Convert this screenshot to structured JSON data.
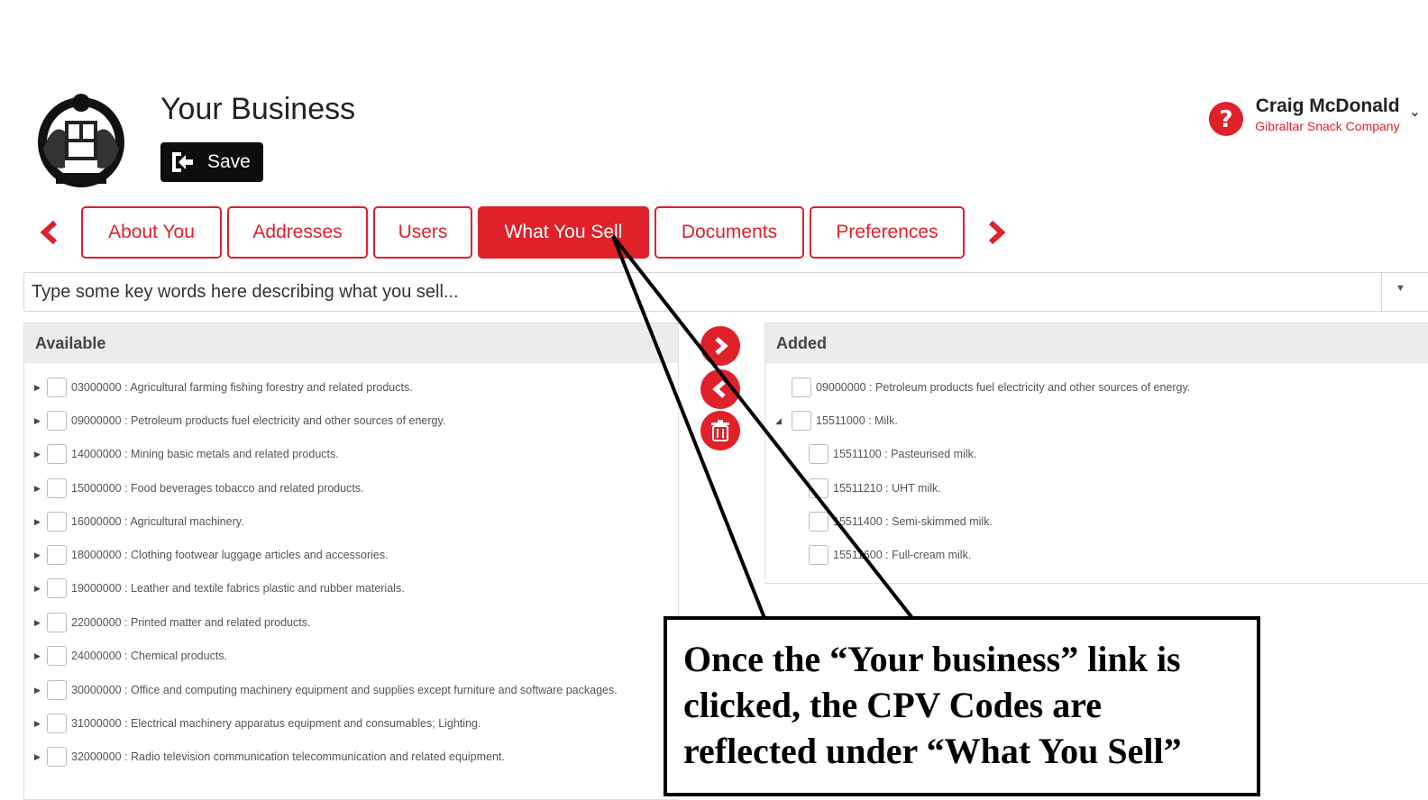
{
  "header": {
    "title": "Your Business",
    "save_label": "Save"
  },
  "user": {
    "name": "Craig McDonald",
    "company": "Gibraltar Snack Company"
  },
  "tabs": [
    {
      "label": "About You"
    },
    {
      "label": "Addresses"
    },
    {
      "label": "Users"
    },
    {
      "label": "What You Sell",
      "active": true
    },
    {
      "label": "Documents"
    },
    {
      "label": "Preferences"
    }
  ],
  "search": {
    "placeholder": "Type some key words here describing what you sell..."
  },
  "available": {
    "title": "Available",
    "items": [
      {
        "code": "03000000",
        "label": "03000000 : Agricultural farming fishing forestry and related products."
      },
      {
        "code": "09000000",
        "label": "09000000 : Petroleum products fuel electricity and other sources of energy."
      },
      {
        "code": "14000000",
        "label": "14000000 : Mining basic metals and related products."
      },
      {
        "code": "15000000",
        "label": "15000000 : Food beverages tobacco and related products."
      },
      {
        "code": "16000000",
        "label": "16000000 : Agricultural machinery."
      },
      {
        "code": "18000000",
        "label": "18000000 : Clothing footwear luggage articles and accessories."
      },
      {
        "code": "19000000",
        "label": "19000000 : Leather and textile fabrics plastic and rubber materials."
      },
      {
        "code": "22000000",
        "label": "22000000 : Printed matter and related products."
      },
      {
        "code": "24000000",
        "label": "24000000 : Chemical products."
      },
      {
        "code": "30000000",
        "label": "30000000 : Office and computing machinery equipment and supplies except furniture and software packages."
      },
      {
        "code": "31000000",
        "label": "31000000 : Electrical machinery apparatus equipment and consumables; Lighting."
      },
      {
        "code": "32000000",
        "label": "32000000 : Radio television communication telecommunication and related equipment."
      }
    ]
  },
  "added": {
    "title": "Added",
    "items": [
      {
        "label": "09000000 : Petroleum products fuel electricity and other sources of energy."
      },
      {
        "label": "15511000 : Milk."
      },
      {
        "label": "15511100 : Pasteurised milk."
      },
      {
        "label": "15511210 : UHT milk."
      },
      {
        "label": "15511400 : Semi-skimmed milk."
      },
      {
        "label": "15511600 : Full-cream milk."
      }
    ]
  },
  "icons": {
    "help": "question-circle-icon",
    "save": "save-arrow-icon",
    "add": "chevron-right-icon",
    "remove": "chevron-left-icon",
    "delete": "trash-icon"
  },
  "colors": {
    "accent": "#e0212a",
    "save_button": "#0d0d0d",
    "panel_header": "#ececec"
  },
  "callout": {
    "line1": "Once the “Your business” link is",
    "line2": "clicked, the CPV Codes are",
    "line3": "reflected under “What You Sell”"
  }
}
